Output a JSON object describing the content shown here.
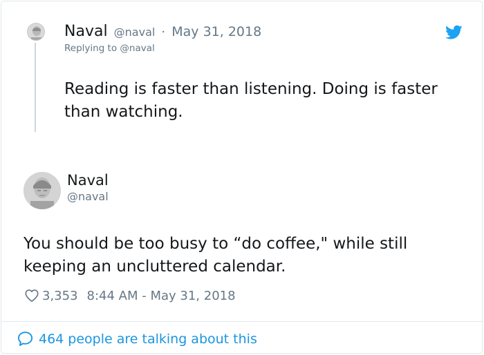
{
  "parent_tweet": {
    "name": "Naval",
    "handle": "@naval",
    "separator": "·",
    "date": "May 31, 2018",
    "replying_to": "Replying to @naval",
    "text": "Reading is faster than listening. Doing is faster than watching."
  },
  "main_tweet": {
    "name": "Naval",
    "handle": "@naval",
    "text": "You should be too busy to “do coffee,\" while still keeping an uncluttered calendar.",
    "like_count": "3,353",
    "timestamp": "8:44 AM - May 31, 2018"
  },
  "footer": {
    "talking_text": "464 people are talking about this"
  },
  "icons": {
    "brand": "twitter-bird-icon",
    "like": "heart-icon",
    "conversation": "speech-bubble-icon"
  },
  "colors": {
    "twitter_blue": "#1da1f2",
    "link_blue": "#1b95e0",
    "muted_gray": "#657786",
    "text": "#14171a",
    "border": "#e1e8ed"
  }
}
